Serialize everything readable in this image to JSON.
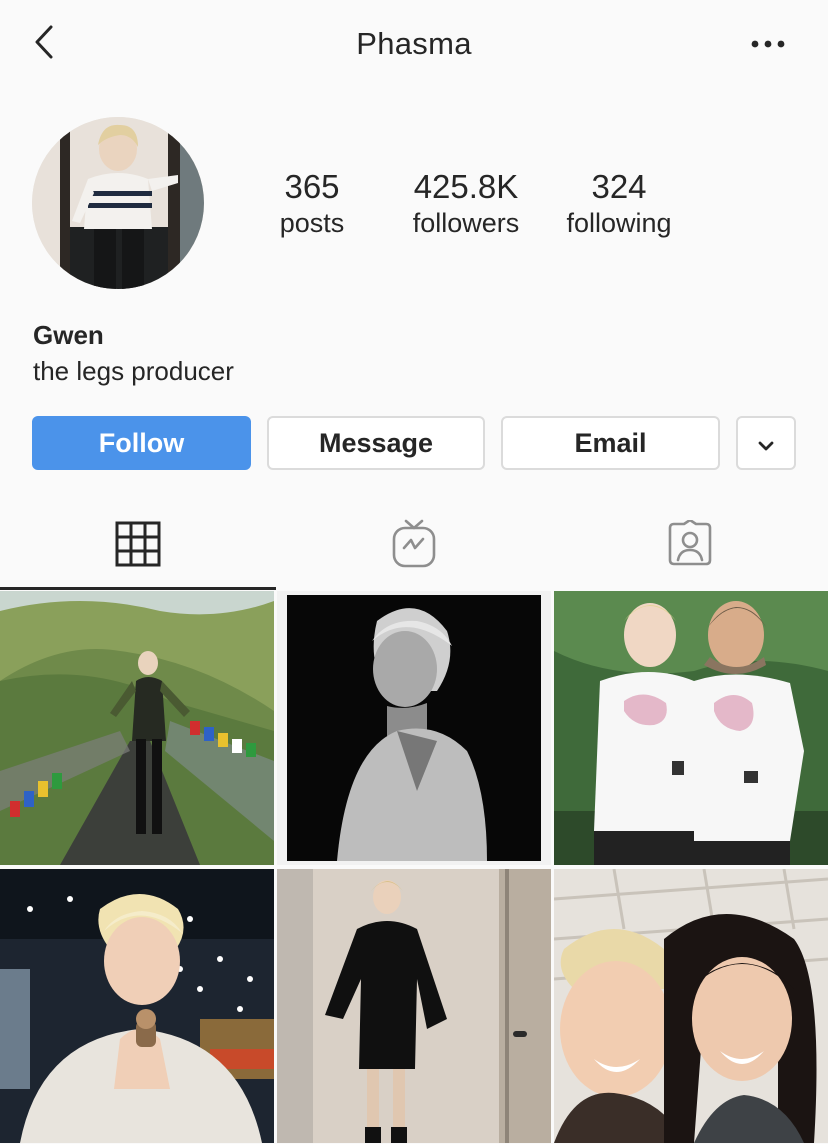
{
  "header": {
    "title": "Phasma",
    "back_icon": "chevron-left-icon",
    "more_icon": "more-horizontal-icon"
  },
  "profile": {
    "stats": {
      "posts_count": "365",
      "posts_label": "posts",
      "followers_count": "425.8K",
      "followers_label": "followers",
      "following_count": "324",
      "following_label": "following"
    },
    "name": "Gwen",
    "bio": "the legs producer"
  },
  "actions": {
    "follow_label": "Follow",
    "message_label": "Message",
    "email_label": "Email",
    "more_icon": "chevron-down-icon"
  },
  "tabs": [
    {
      "icon": "grid-icon",
      "active": true
    },
    {
      "icon": "igtv-icon",
      "active": false
    },
    {
      "icon": "tagged-person-icon",
      "active": false
    }
  ],
  "colors": {
    "follow_button": "#4b93ea",
    "text": "#262626",
    "border": "#dbdbdb",
    "background": "#fafafa"
  }
}
